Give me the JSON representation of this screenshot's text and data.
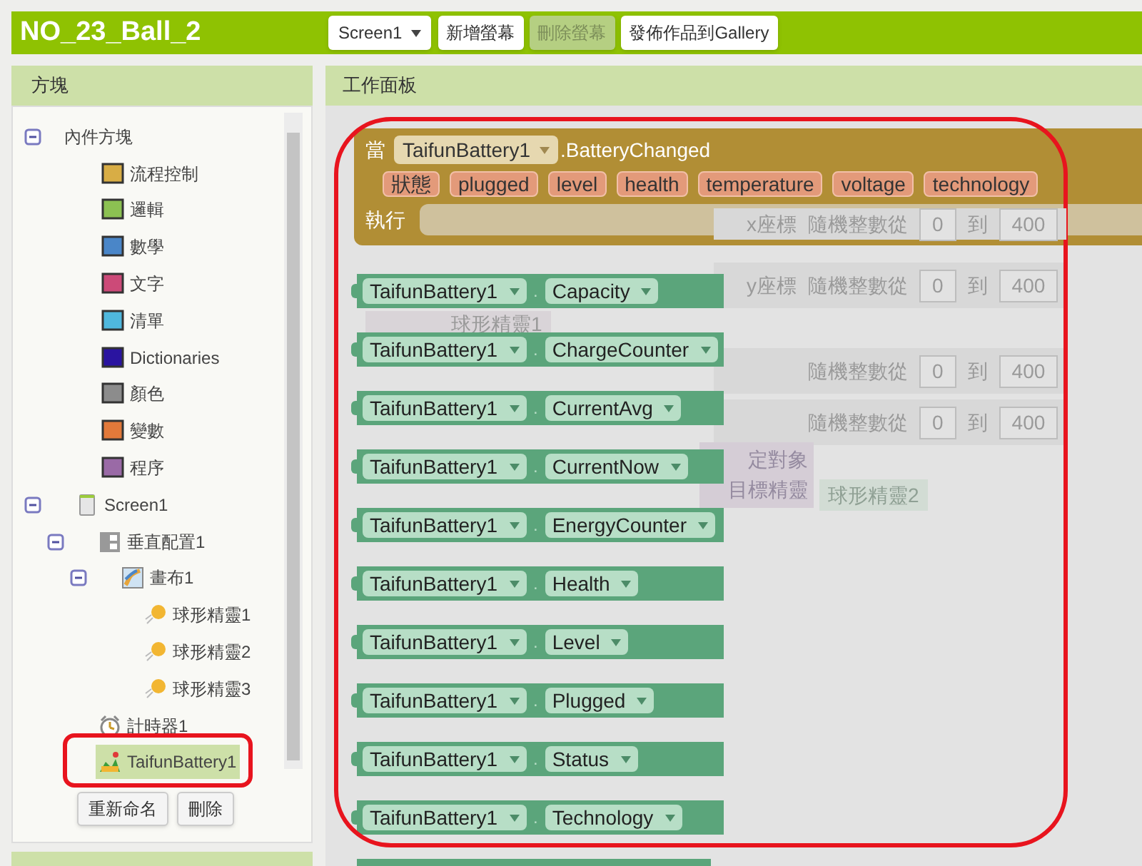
{
  "app_bar": {
    "title": "NO_23_Ball_2",
    "screen_dropdown": "Screen1",
    "buttons": [
      {
        "label": "新增螢幕",
        "disabled": false
      },
      {
        "label": "刪除螢幕",
        "disabled": true
      },
      {
        "label": "發佈作品到Gallery",
        "disabled": false
      }
    ]
  },
  "blocks_panel": {
    "title": "方塊",
    "tree": [
      {
        "label": "內件方塊",
        "kind": "group",
        "expanded": true,
        "selected": false,
        "children": [
          {
            "label": "流程控制",
            "kind": "category",
            "color": "#d8ad45",
            "selected": false
          },
          {
            "label": "邏輯",
            "kind": "category",
            "color": "#8cc152",
            "selected": false
          },
          {
            "label": "數學",
            "kind": "category",
            "color": "#4a86c8",
            "selected": false
          },
          {
            "label": "文字",
            "kind": "category",
            "color": "#cc4a78",
            "selected": false
          },
          {
            "label": "清單",
            "kind": "category",
            "color": "#4fb8de",
            "selected": false
          },
          {
            "label": "Dictionaries",
            "kind": "category",
            "color": "#2a14a0",
            "selected": false
          },
          {
            "label": "顏色",
            "kind": "category",
            "color": "#8c8c8c",
            "selected": false
          },
          {
            "label": "變數",
            "kind": "category",
            "color": "#e2793a",
            "selected": false
          },
          {
            "label": "程序",
            "kind": "category",
            "color": "#9a6aa6",
            "selected": false
          }
        ]
      },
      {
        "label": "Screen1",
        "kind": "screen",
        "expanded": true,
        "selected": false,
        "children": [
          {
            "label": "垂直配置1",
            "kind": "arrangement",
            "expanded": true,
            "selected": false,
            "children": [
              {
                "label": "畫布1",
                "kind": "canvas",
                "expanded": true,
                "selected": false,
                "children": [
                  {
                    "label": "球形精靈1",
                    "kind": "sprite",
                    "selected": false
                  },
                  {
                    "label": "球形精靈2",
                    "kind": "sprite",
                    "selected": false
                  },
                  {
                    "label": "球形精靈3",
                    "kind": "sprite",
                    "selected": false
                  }
                ]
              }
            ]
          },
          {
            "label": "計時器1",
            "kind": "clock",
            "selected": false
          },
          {
            "label": "TaifunBattery1",
            "kind": "extension",
            "selected": true
          }
        ]
      }
    ],
    "buttons": [
      "重新命名",
      "刪除"
    ]
  },
  "viewer": {
    "title": "工作面板",
    "event_block": {
      "prefix": "當",
      "component": "TaifunBattery1",
      "event": ".BatteryChanged",
      "params": [
        "狀態",
        "plugged",
        "level",
        "health",
        "temperature",
        "voltage",
        "technology"
      ],
      "do_label": "執行"
    },
    "getter_blocks": [
      {
        "component": "TaifunBattery1",
        "dot": ".",
        "property": "Capacity"
      },
      {
        "component": "TaifunBattery1",
        "dot": ".",
        "property": "ChargeCounter"
      },
      {
        "component": "TaifunBattery1",
        "dot": ".",
        "property": "CurrentAvg"
      },
      {
        "component": "TaifunBattery1",
        "dot": ".",
        "property": "CurrentNow"
      },
      {
        "component": "TaifunBattery1",
        "dot": ".",
        "property": "EnergyCounter"
      },
      {
        "component": "TaifunBattery1",
        "dot": ".",
        "property": "Health"
      },
      {
        "component": "TaifunBattery1",
        "dot": ".",
        "property": "Level"
      },
      {
        "component": "TaifunBattery1",
        "dot": ".",
        "property": "Plugged"
      },
      {
        "component": "TaifunBattery1",
        "dot": ".",
        "property": "Status"
      },
      {
        "component": "TaifunBattery1",
        "dot": ".",
        "property": "Technology"
      }
    ],
    "ghost_rows": [
      {
        "label": "x座標",
        "parts": [
          "隨機整數從",
          "0",
          "到",
          "400"
        ]
      },
      {
        "label": "y座標",
        "parts": [
          "隨機整數從",
          "0",
          "到",
          "400"
        ]
      },
      {
        "parts": [
          "隨機整數從",
          "0",
          "到",
          "400"
        ]
      },
      {
        "parts": [
          "隨機整數從",
          "0",
          "到",
          "400"
        ]
      }
    ],
    "ghost_call": {
      "value": "球形精靈1"
    },
    "ghost_target": {
      "label": "定對象",
      "param": "目標精靈",
      "value": "球形精靈2"
    }
  }
}
